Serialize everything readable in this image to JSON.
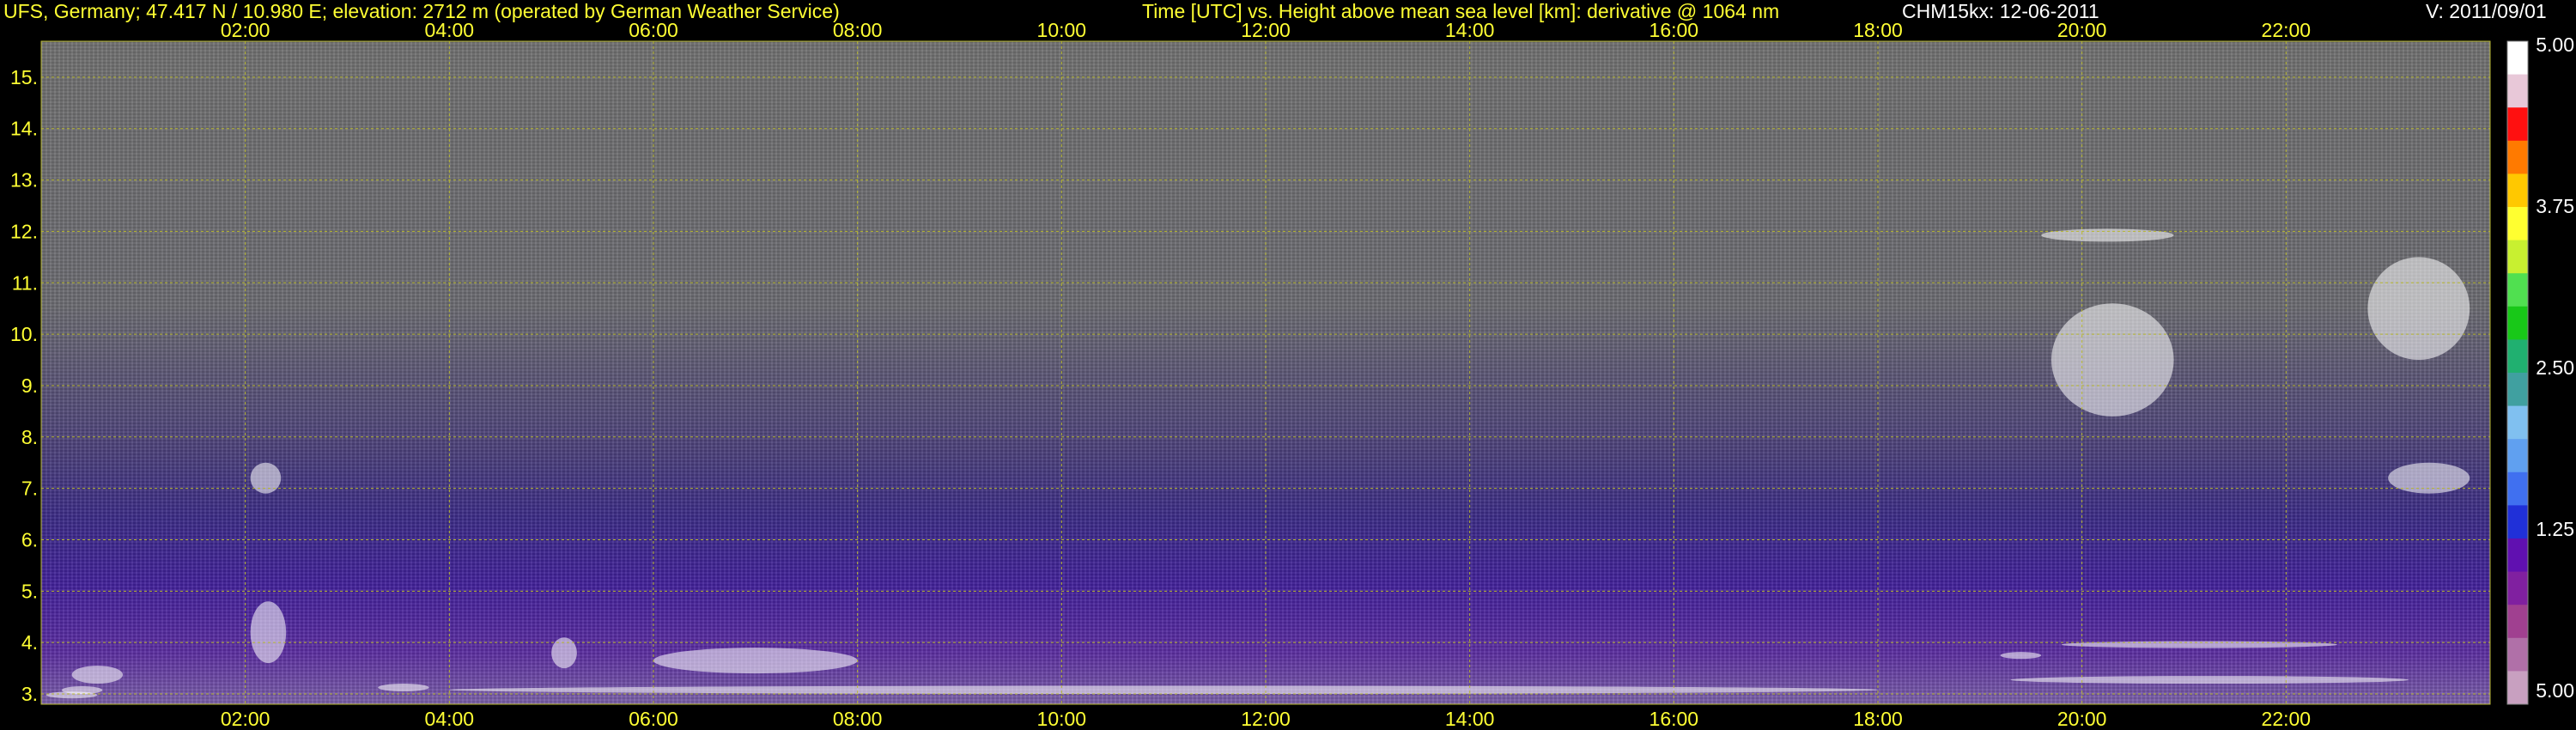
{
  "header": {
    "site": "UFS, Germany; 47.417 N / 10.980 E; elevation: 2712 m  (operated by German Weather Service)",
    "plot_title": "Time [UTC] vs. Height above mean sea level [km]: derivative @ 1064 nm",
    "instrument": "CHM15kx: 12-06-2011",
    "version": "V: 2011/09/01"
  },
  "colors": {
    "axis_text": "#ffff33",
    "grid": "#b8b830",
    "background": "#000000"
  },
  "chart_data": {
    "type": "heatmap",
    "title": "Time [UTC] vs. Height above mean sea level [km]: derivative @ 1064 nm",
    "xlabel": "Time [UTC]",
    "ylabel": "Height above mean sea level [km]",
    "x_range_hours": [
      0,
      24
    ],
    "y_range_km": [
      2.8,
      15.7
    ],
    "x_ticks": [
      "02:00",
      "04:00",
      "06:00",
      "08:00",
      "10:00",
      "12:00",
      "14:00",
      "16:00",
      "18:00",
      "20:00",
      "22:00"
    ],
    "y_ticks": [
      "3.",
      "4.",
      "5.",
      "6.",
      "7.",
      "8.",
      "9.",
      "10.",
      "11.",
      "12.",
      "13.",
      "14.",
      "15."
    ],
    "grid": true,
    "colorbar": {
      "labels": [
        "5.00",
        "3.75",
        "2.50",
        "1.25",
        "5.00"
      ],
      "colors": [
        "#ffffff",
        "#e8c8d8",
        "#ff1010",
        "#ff7a00",
        "#ffc800",
        "#ffff30",
        "#c8f030",
        "#50e050",
        "#18c818",
        "#20b070",
        "#40a0a0",
        "#80c0f0",
        "#60a0f0",
        "#4070f0",
        "#2030d8",
        "#6010b0",
        "#8020a0",
        "#a04090",
        "#b070a8",
        "#c8a0c0"
      ]
    }
  }
}
